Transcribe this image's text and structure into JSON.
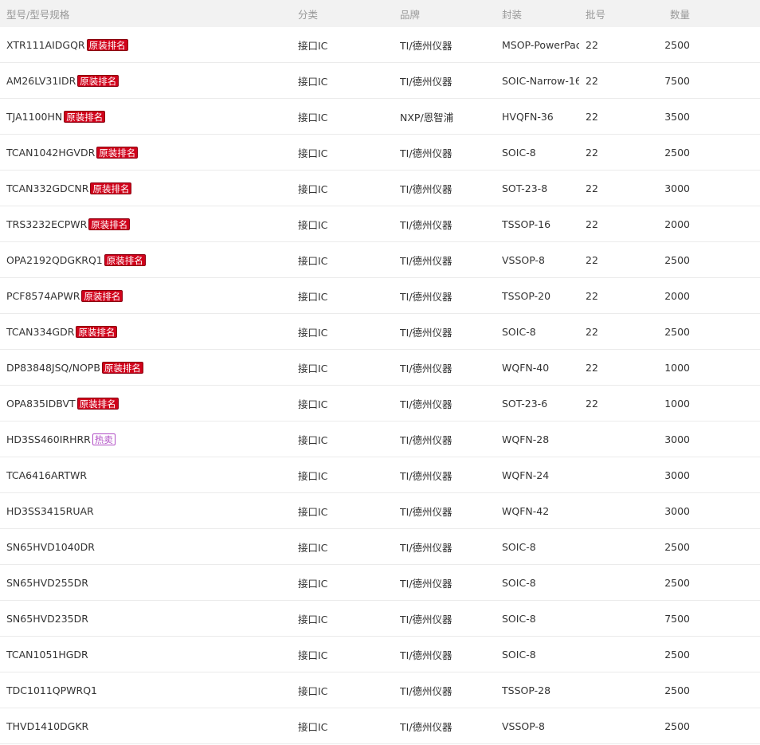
{
  "headers": {
    "model": "型号/型号规格",
    "category": "分类",
    "brand": "品牌",
    "package": "封装",
    "lot": "批号",
    "qty": "数量"
  },
  "colors": {
    "badge_original": "#d0021b",
    "badge_hot": "#b14fc5",
    "header_bg": "#f2f2f2"
  },
  "rows": [
    {
      "model": "XTR111AIDGQR",
      "badge": "原装排名",
      "badge_type": "red",
      "category": "接口IC",
      "brand": "TI/德州仪器",
      "package": "MSOP-PowerPac",
      "lot": "22",
      "qty": "2500"
    },
    {
      "model": "AM26LV31IDR",
      "badge": "原装排名",
      "badge_type": "red",
      "category": "接口IC",
      "brand": "TI/德州仪器",
      "package": "SOIC-Narrow-16",
      "lot": "22",
      "qty": "7500"
    },
    {
      "model": "TJA1100HN",
      "badge": "原装排名",
      "badge_type": "red",
      "category": "接口IC",
      "brand": "NXP/恩智浦",
      "package": "HVQFN-36",
      "lot": "22",
      "qty": "3500"
    },
    {
      "model": "TCAN1042HGVDR",
      "badge": "原装排名",
      "badge_type": "red",
      "category": "接口IC",
      "brand": "TI/德州仪器",
      "package": "SOIC-8",
      "lot": "22",
      "qty": "2500"
    },
    {
      "model": "TCAN332GDCNR",
      "badge": "原装排名",
      "badge_type": "red",
      "category": "接口IC",
      "brand": "TI/德州仪器",
      "package": "SOT-23-8",
      "lot": "22",
      "qty": "3000"
    },
    {
      "model": "TRS3232ECPWR",
      "badge": "原装排名",
      "badge_type": "red",
      "category": "接口IC",
      "brand": "TI/德州仪器",
      "package": "TSSOP-16",
      "lot": "22",
      "qty": "2000"
    },
    {
      "model": "OPA2192QDGKRQ1",
      "badge": "原装排名",
      "badge_type": "red",
      "category": "接口IC",
      "brand": "TI/德州仪器",
      "package": "VSSOP-8",
      "lot": "22",
      "qty": "2500"
    },
    {
      "model": "PCF8574APWR",
      "badge": "原装排名",
      "badge_type": "red",
      "category": "接口IC",
      "brand": "TI/德州仪器",
      "package": "TSSOP-20",
      "lot": "22",
      "qty": "2000"
    },
    {
      "model": "TCAN334GDR",
      "badge": "原装排名",
      "badge_type": "red",
      "category": "接口IC",
      "brand": "TI/德州仪器",
      "package": "SOIC-8",
      "lot": "22",
      "qty": "2500"
    },
    {
      "model": "DP83848JSQ/NOPB",
      "badge": "原装排名",
      "badge_type": "red",
      "category": "接口IC",
      "brand": "TI/德州仪器",
      "package": "WQFN-40",
      "lot": "22",
      "qty": "1000"
    },
    {
      "model": "OPA835IDBVT",
      "badge": "原装排名",
      "badge_type": "red",
      "category": "接口IC",
      "brand": "TI/德州仪器",
      "package": "SOT-23-6",
      "lot": "22",
      "qty": "1000"
    },
    {
      "model": "HD3SS460IRHRR",
      "badge": "热卖",
      "badge_type": "hot",
      "category": "接口IC",
      "brand": "TI/德州仪器",
      "package": "WQFN-28",
      "lot": "",
      "qty": "3000"
    },
    {
      "model": "TCA6416ARTWR",
      "badge": "",
      "badge_type": "",
      "category": "接口IC",
      "brand": "TI/德州仪器",
      "package": "WQFN-24",
      "lot": "",
      "qty": "3000"
    },
    {
      "model": "HD3SS3415RUAR",
      "badge": "",
      "badge_type": "",
      "category": "接口IC",
      "brand": "TI/德州仪器",
      "package": "WQFN-42",
      "lot": "",
      "qty": "3000"
    },
    {
      "model": "SN65HVD1040DR",
      "badge": "",
      "badge_type": "",
      "category": "接口IC",
      "brand": "TI/德州仪器",
      "package": "SOIC-8",
      "lot": "",
      "qty": "2500"
    },
    {
      "model": "SN65HVD255DR",
      "badge": "",
      "badge_type": "",
      "category": "接口IC",
      "brand": "TI/德州仪器",
      "package": "SOIC-8",
      "lot": "",
      "qty": "2500"
    },
    {
      "model": "SN65HVD235DR",
      "badge": "",
      "badge_type": "",
      "category": "接口IC",
      "brand": "TI/德州仪器",
      "package": "SOIC-8",
      "lot": "",
      "qty": "7500"
    },
    {
      "model": "TCAN1051HGDR",
      "badge": "",
      "badge_type": "",
      "category": "接口IC",
      "brand": "TI/德州仪器",
      "package": "SOIC-8",
      "lot": "",
      "qty": "2500"
    },
    {
      "model": "TDC1011QPWRQ1",
      "badge": "",
      "badge_type": "",
      "category": "接口IC",
      "brand": "TI/德州仪器",
      "package": "TSSOP-28",
      "lot": "",
      "qty": "2500"
    },
    {
      "model": "THVD1410DGKR",
      "badge": "",
      "badge_type": "",
      "category": "接口IC",
      "brand": "TI/德州仪器",
      "package": "VSSOP-8",
      "lot": "",
      "qty": "2500"
    }
  ]
}
